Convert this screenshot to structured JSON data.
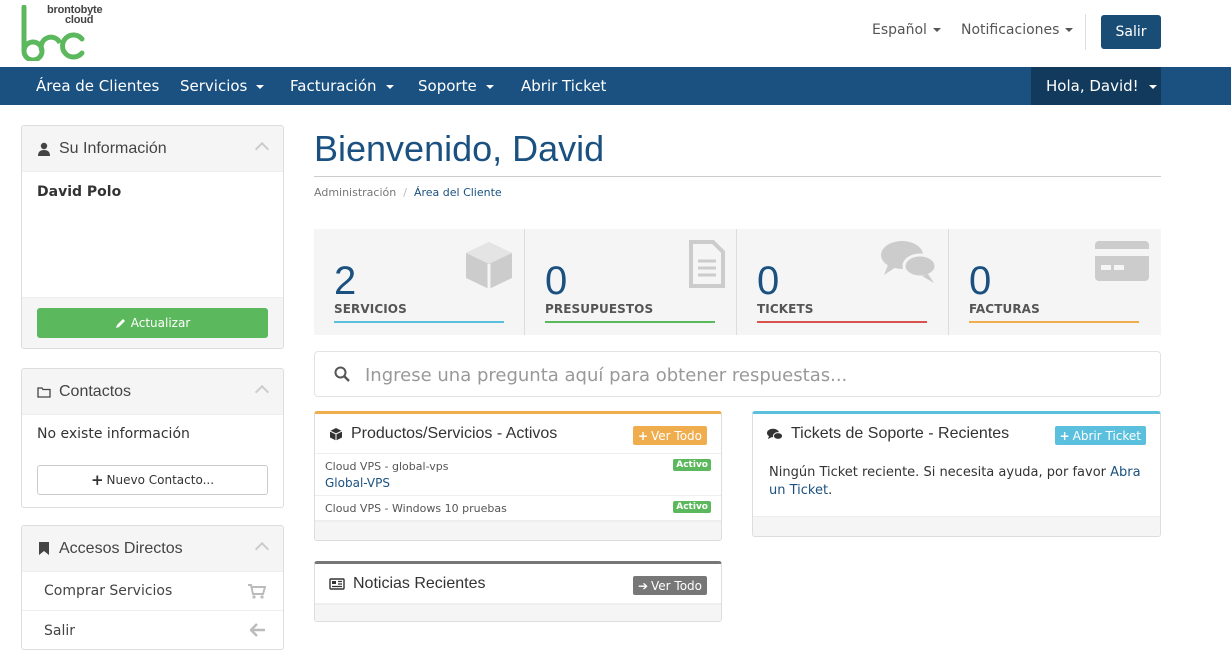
{
  "brand": {
    "line1": "brontobyte",
    "line2": "cloud"
  },
  "header": {
    "language_label": "Español",
    "notifications_label": "Notificaciones",
    "logout_label": "Salir"
  },
  "nav": {
    "items": [
      {
        "label": "Área de Clientes"
      },
      {
        "label": "Servicios"
      },
      {
        "label": "Facturación"
      },
      {
        "label": "Soporte"
      },
      {
        "label": "Abrir Ticket"
      }
    ],
    "user_label": "Hola, David!"
  },
  "sidebar": {
    "info": {
      "title": "Su Información",
      "name": "David Polo",
      "update_label": "Actualizar"
    },
    "contacts": {
      "title": "Contactos",
      "empty_text": "No existe información",
      "new_label": "Nuevo Contacto..."
    },
    "shortcuts": {
      "title": "Accesos Directos",
      "items": [
        {
          "label": "Comprar Servicios",
          "icon": "cart-icon"
        },
        {
          "label": "Salir",
          "icon": "arrow-left-icon"
        }
      ]
    }
  },
  "main": {
    "title": "Bienvenido, David",
    "breadcrumb": {
      "root": "Administración",
      "current": "Área del Cliente"
    },
    "tiles": [
      {
        "value": "2",
        "label": "SERVICIOS",
        "color": "#5bc0de",
        "icon": "cube-icon"
      },
      {
        "value": "0",
        "label": "PRESUPUESTOS",
        "color": "#5cb85c",
        "icon": "document-icon"
      },
      {
        "value": "0",
        "label": "TICKETS",
        "color": "#d9534f",
        "icon": "chat-icon"
      },
      {
        "value": "0",
        "label": "FACTURAS",
        "color": "#f0ad4e",
        "icon": "credit-card-icon"
      }
    ],
    "search_placeholder": "Ingrese una pregunta aquí para obtener respuestas...",
    "products": {
      "title": "Productos/Servicios - Activos",
      "view_all_label": "Ver Todo",
      "rows": [
        {
          "name": "Cloud VPS - global-vps",
          "link": "Global-VPS",
          "status": "Activo"
        },
        {
          "name": "Cloud VPS - Windows 10 pruebas",
          "status": "Activo"
        }
      ]
    },
    "tickets": {
      "title": "Tickets de Soporte - Recientes",
      "open_label": "Abrir Ticket",
      "text": "Ningún Ticket reciente. Si necesita ayuda, por favor",
      "link1": "Abra un",
      "link2": "Ticket",
      "text_end": "."
    },
    "news": {
      "title": "Noticias Recientes",
      "view_all_label": "Ver Todo"
    }
  },
  "colors": {
    "brand_blue": "#1a5180",
    "green": "#5cb85c",
    "orange": "#f0ad4e",
    "info": "#5bc0de",
    "grey_btn": "#777777"
  }
}
